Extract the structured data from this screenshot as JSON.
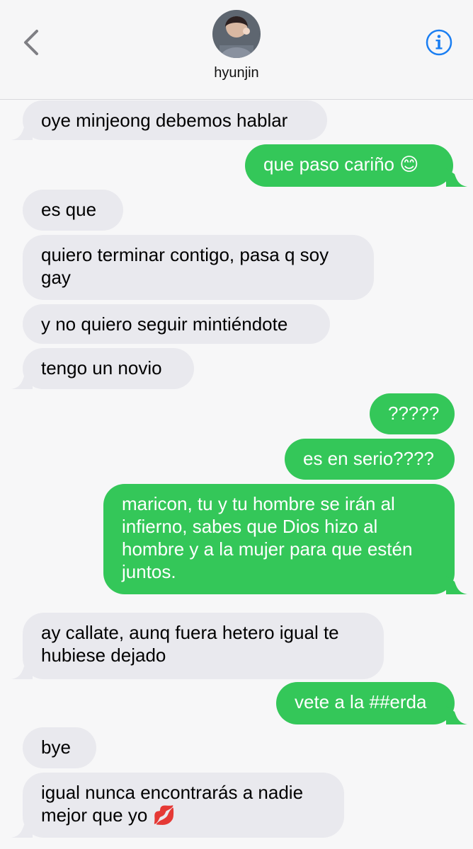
{
  "header": {
    "contact_name": "hyunjin",
    "back_icon": "chevron-left-icon",
    "info_icon": "info-icon",
    "accent_color": "#1a7ef2"
  },
  "colors": {
    "incoming_bubble": "#e9e9ee",
    "outgoing_bubble": "#34c759"
  },
  "messages": [
    {
      "direction": "incoming",
      "text": "oye minjeong debemos hablar"
    },
    {
      "direction": "outgoing",
      "text": "que paso cariño 😊"
    },
    {
      "direction": "incoming",
      "text": "es que"
    },
    {
      "direction": "incoming",
      "text": "quiero terminar contigo, pasa q soy\ngay"
    },
    {
      "direction": "incoming",
      "text": "y no quiero seguir mintiéndote"
    },
    {
      "direction": "incoming",
      "text": "tengo un novio"
    },
    {
      "direction": "outgoing",
      "text": "?????"
    },
    {
      "direction": "outgoing",
      "text": "es en serio????"
    },
    {
      "direction": "outgoing",
      "text": "maricon, tu y tu hombre se irán al\ninfierno, sabes que Dios hizo al\nhombre y a la mujer para que estén\njuntos."
    },
    {
      "direction": "incoming",
      "text": "ay callate, aunq fuera hetero igual te\nhubiese dejado"
    },
    {
      "direction": "outgoing",
      "text": "vete a la ##erda"
    },
    {
      "direction": "incoming",
      "text": "bye"
    },
    {
      "direction": "incoming",
      "text": "igual nunca encontrarás a nadie\nmejor que yo 💋"
    }
  ]
}
